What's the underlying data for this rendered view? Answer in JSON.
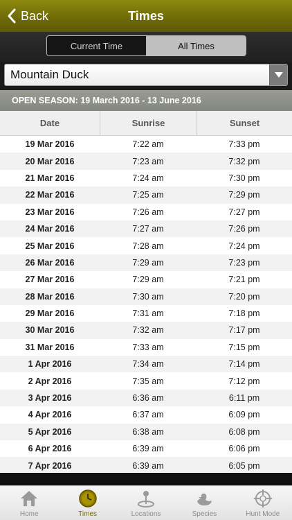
{
  "nav": {
    "back_label": "Back",
    "title": "Times"
  },
  "segments": {
    "current": "Current Time",
    "all": "All Times",
    "selected": "all"
  },
  "species": {
    "selected": "Mountain Duck"
  },
  "season": {
    "label": "OPEN SEASON: 19 March 2016 - 13 June 2016"
  },
  "table": {
    "headers": {
      "date": "Date",
      "sunrise": "Sunrise",
      "sunset": "Sunset"
    },
    "rows": [
      {
        "date": "19 Mar 2016",
        "sunrise": "7:22 am",
        "sunset": "7:33 pm"
      },
      {
        "date": "20 Mar 2016",
        "sunrise": "7:23 am",
        "sunset": "7:32 pm"
      },
      {
        "date": "21 Mar 2016",
        "sunrise": "7:24 am",
        "sunset": "7:30 pm"
      },
      {
        "date": "22 Mar 2016",
        "sunrise": "7:25 am",
        "sunset": "7:29 pm"
      },
      {
        "date": "23 Mar 2016",
        "sunrise": "7:26 am",
        "sunset": "7:27 pm"
      },
      {
        "date": "24 Mar 2016",
        "sunrise": "7:27 am",
        "sunset": "7:26 pm"
      },
      {
        "date": "25 Mar 2016",
        "sunrise": "7:28 am",
        "sunset": "7:24 pm"
      },
      {
        "date": "26 Mar 2016",
        "sunrise": "7:29 am",
        "sunset": "7:23 pm"
      },
      {
        "date": "27 Mar 2016",
        "sunrise": "7:29 am",
        "sunset": "7:21 pm"
      },
      {
        "date": "28 Mar 2016",
        "sunrise": "7:30 am",
        "sunset": "7:20 pm"
      },
      {
        "date": "29 Mar 2016",
        "sunrise": "7:31 am",
        "sunset": "7:18 pm"
      },
      {
        "date": "30 Mar 2016",
        "sunrise": "7:32 am",
        "sunset": "7:17 pm"
      },
      {
        "date": "31 Mar 2016",
        "sunrise": "7:33 am",
        "sunset": "7:15 pm"
      },
      {
        "date": "1 Apr 2016",
        "sunrise": "7:34 am",
        "sunset": "7:14 pm"
      },
      {
        "date": "2 Apr 2016",
        "sunrise": "7:35 am",
        "sunset": "7:12 pm"
      },
      {
        "date": "3 Apr 2016",
        "sunrise": "6:36 am",
        "sunset": "6:11 pm"
      },
      {
        "date": "4 Apr 2016",
        "sunrise": "6:37 am",
        "sunset": "6:09 pm"
      },
      {
        "date": "5 Apr 2016",
        "sunrise": "6:38 am",
        "sunset": "6:08 pm"
      },
      {
        "date": "6 Apr 2016",
        "sunrise": "6:39 am",
        "sunset": "6:06 pm"
      },
      {
        "date": "7 Apr 2016",
        "sunrise": "6:39 am",
        "sunset": "6:05 pm"
      }
    ]
  },
  "tabs": [
    {
      "label": "Home",
      "icon": "house-icon",
      "active": false
    },
    {
      "label": "Times",
      "icon": "clock-icon",
      "active": true
    },
    {
      "label": "Locations",
      "icon": "map-pin-icon",
      "active": false
    },
    {
      "label": "Species",
      "icon": "duck-icon",
      "active": false
    },
    {
      "label": "Hunt Mode",
      "icon": "crosshair-icon",
      "active": false
    }
  ],
  "colors": {
    "navbar": "#7a760a",
    "active_tab": "#7a6a00",
    "season_bar": "#8d9087"
  }
}
